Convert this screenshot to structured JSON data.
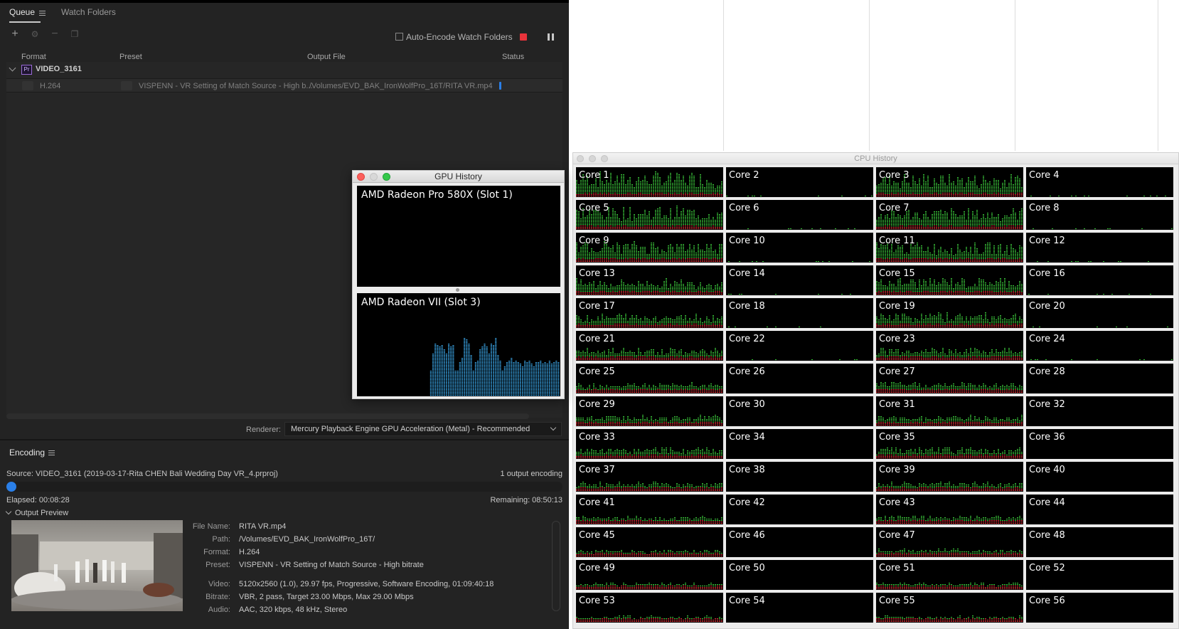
{
  "queue": {
    "tab_label": "Queue",
    "watch_tab_label": "Watch Folders",
    "auto_encode_label": "Auto-Encode Watch Folders",
    "columns": {
      "format": "Format",
      "preset": "Preset",
      "output": "Output File",
      "status": "Status"
    },
    "group": {
      "badge": "Pr",
      "name": "VIDEO_3161"
    },
    "item": {
      "format": "H.264",
      "preset": "VISPENN - VR Setting of Match Source - High b...",
      "output": "/Volumes/EVD_BAK_IronWolfPro_16T/RITA VR.mp4"
    },
    "renderer_label": "Renderer:",
    "renderer_value": "Mercury Playback Engine GPU Acceleration (Metal) - Recommended"
  },
  "encoding": {
    "tab_label": "Encoding",
    "source": "Source: VIDEO_3161 (2019-03-17-Rita CHEN Bali Wedding Day VR_4.prproj)",
    "output_count": "1 output encoding",
    "progress_fraction": 0.016,
    "elapsed": "Elapsed: 00:08:28",
    "remaining": "Remaining: 08:50:13",
    "preview_label": "Output Preview",
    "meta": [
      {
        "k": "File Name:",
        "v": "RITA VR.mp4"
      },
      {
        "k": "Path:",
        "v": "/Volumes/EVD_BAK_IronWolfPro_16T/"
      },
      {
        "k": "Format:",
        "v": "H.264"
      },
      {
        "k": "Preset:",
        "v": "VISPENN - VR Setting of Match Source - High bitrate"
      },
      {
        "k": "Video:",
        "v": "5120x2560 (1.0), 29.97 fps, Progressive, Software Encoding, 01:09:40:18"
      },
      {
        "k": "Bitrate:",
        "v": "VBR, 2 pass, Target 23.00 Mbps, Max 29.00 Mbps"
      },
      {
        "k": "Audio:",
        "v": "AAC, 320 kbps, 48 kHz, Stereo"
      }
    ]
  },
  "gpu": {
    "title": "GPU History",
    "cards": [
      {
        "name": "AMD Radeon Pro 580X (Slot 1)",
        "activity": []
      },
      {
        "name": "AMD Radeon VII (Slot 3)",
        "activity": [
          0,
          0,
          0,
          0,
          0,
          0,
          0,
          0,
          0,
          0,
          0,
          0,
          0,
          0,
          0,
          0,
          0,
          0,
          0,
          0,
          0,
          0,
          0,
          0,
          0,
          0,
          0,
          0,
          0,
          0,
          0,
          0,
          0.3,
          0.5,
          0.62,
          0.6,
          0.58,
          0.6,
          0.55,
          0.5,
          0.62,
          0.58,
          0.6,
          0.3,
          0.3,
          0.4,
          0.45,
          0.68,
          0.66,
          0.62,
          0.48,
          0.3,
          0.4,
          0.42,
          0.55,
          0.58,
          0.62,
          0.58,
          0.5,
          0.62,
          0.6,
          0.68,
          0.48,
          0.42,
          0.3,
          0.35,
          0.4,
          0.42,
          0.45,
          0.4,
          0.42,
          0.4,
          0.38,
          0.35,
          0.42,
          0.4,
          0.42,
          0.38,
          0.35,
          0.4,
          0.4,
          0.42,
          0.38,
          0.4,
          0.38,
          0.42,
          0.38,
          0.4,
          0.42,
          0.4
        ]
      }
    ]
  },
  "cpu": {
    "title": "CPU History",
    "core_prefix": "Core ",
    "core_count": 56,
    "accent_user": "#3fd43f",
    "accent_system": "#e8333b"
  }
}
